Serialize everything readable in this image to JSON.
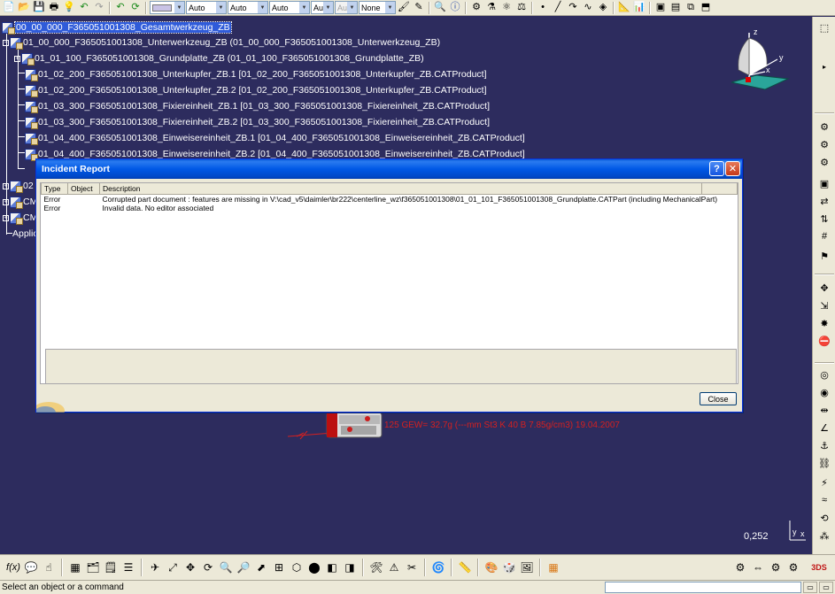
{
  "toolbar": {
    "combo_color": "",
    "combo_auto_1": "Auto",
    "combo_auto_2": "Auto",
    "combo_auto_3": "Auto",
    "combo_aut_4": "Aut",
    "combo_aut_5": "Aut",
    "combo_none": "None"
  },
  "tree": {
    "root": "00_00_000_F365051001308_Gesamtwerkzeug_ZB",
    "nodes": [
      "01_00_000_F365051001308_Unterwerkzeug_ZB (01_00_000_F365051001308_Unterwerkzeug_ZB)",
      "01_01_100_F365051001308_Grundplatte_ZB (01_01_100_F365051001308_Grundplatte_ZB)",
      "01_02_200_F365051001308_Unterkupfer_ZB.1 [01_02_200_F365051001308_Unterkupfer_ZB.CATProduct]",
      "01_02_200_F365051001308_Unterkupfer_ZB.2 [01_02_200_F365051001308_Unterkupfer_ZB.CATProduct]",
      "01_03_300_F365051001308_Fixiereinheit_ZB.1 [01_03_300_F365051001308_Fixiereinheit_ZB.CATProduct]",
      "01_03_300_F365051001308_Fixiereinheit_ZB.2 [01_03_300_F365051001308_Fixiereinheit_ZB.CATProduct]",
      "01_04_400_F365051001308_Einweisereinheit_ZB.1 [01_04_400_F365051001308_Einweisereinheit_ZB.CATProduct]",
      "01_04_400_F365051001308_Einweisereinheit_ZB.2 [01_04_400_F365051001308_Einweisereinheit_ZB.CATProduct]"
    ],
    "partial_nodes": [
      "02",
      "CM",
      "CM",
      "Applica"
    ]
  },
  "compass": {
    "z": "z",
    "y": "y",
    "x": "x"
  },
  "annotation": "125 GEW= 32.7g (---mm St3 K 40 B 7.85g/cm3) 19.04.2007",
  "zoom": "0,252",
  "axis_mini": {
    "y": "y",
    "x": "x"
  },
  "dialog": {
    "title": "Incident Report",
    "help_label": "?",
    "close_x": "✕",
    "columns": [
      "Type",
      "Object",
      "Description"
    ],
    "rows": [
      {
        "type": "Error",
        "object": "",
        "description": "Corrupted part document : features are missing in V:\\cad_v5\\daimler\\br222\\centerline_wz\\f365051001308\\01_01_101_F365051001308_Grundplatte.CATPart (including MechanicalPart)"
      },
      {
        "type": "Error",
        "object": "",
        "description": "Invalid data. No editor associated"
      }
    ],
    "close_label": "Close"
  },
  "status": {
    "text": "Select an object or a command",
    "command_value": ""
  },
  "colors": {
    "background": "#2d2c5e",
    "selection": "#2f5bd9",
    "annotation": "#d42020",
    "titlebar": "#0058e6"
  }
}
